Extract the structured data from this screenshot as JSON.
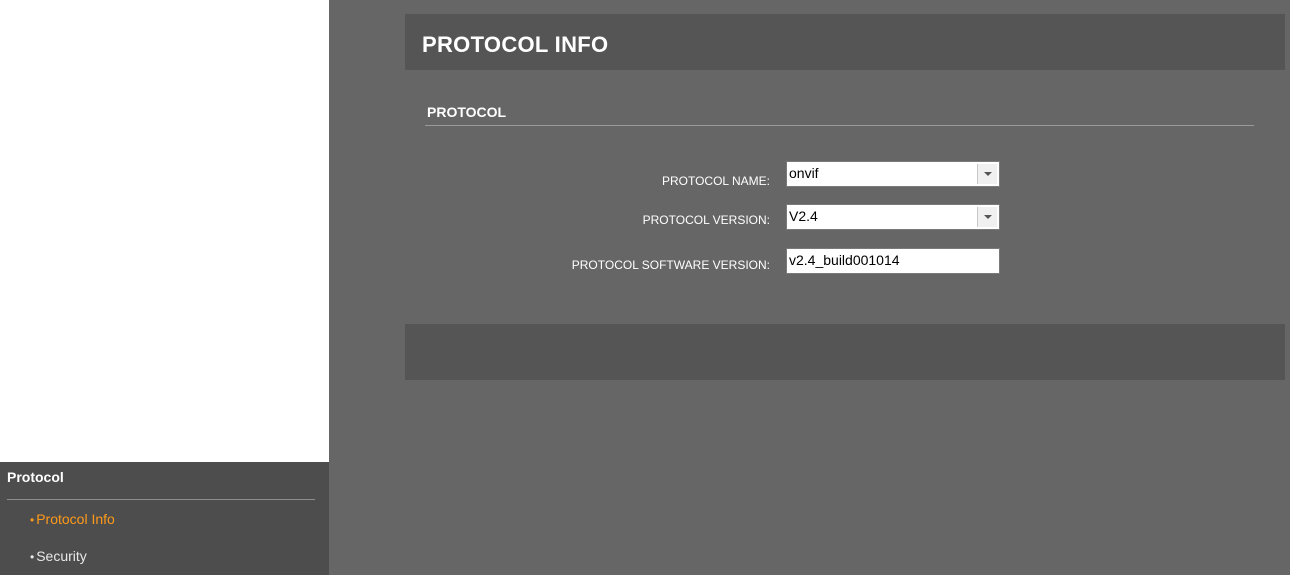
{
  "sidebar": {
    "heading": "Protocol",
    "items": [
      {
        "label": "Protocol Info",
        "active": true
      },
      {
        "label": "Security",
        "active": false
      }
    ],
    "bullet": "•"
  },
  "main": {
    "title": "PROTOCOL INFO",
    "section_title": "PROTOCOL",
    "fields": {
      "protocol_name_label": "PROTOCOL NAME:",
      "protocol_name_value": "onvif",
      "protocol_version_label": "PROTOCOL VERSION:",
      "protocol_version_value": "V2.4",
      "software_version_label": "PROTOCOL SOFTWARE VERSION:",
      "software_version_value": "v2.4_build001014"
    }
  },
  "colors": {
    "active_item": "#ff9a1a",
    "sidebar_bg": "#4d4d4d",
    "content_bg": "#666666",
    "header_bg": "#555555"
  },
  "icons": {
    "dropdown": "chevron-down-icon"
  }
}
